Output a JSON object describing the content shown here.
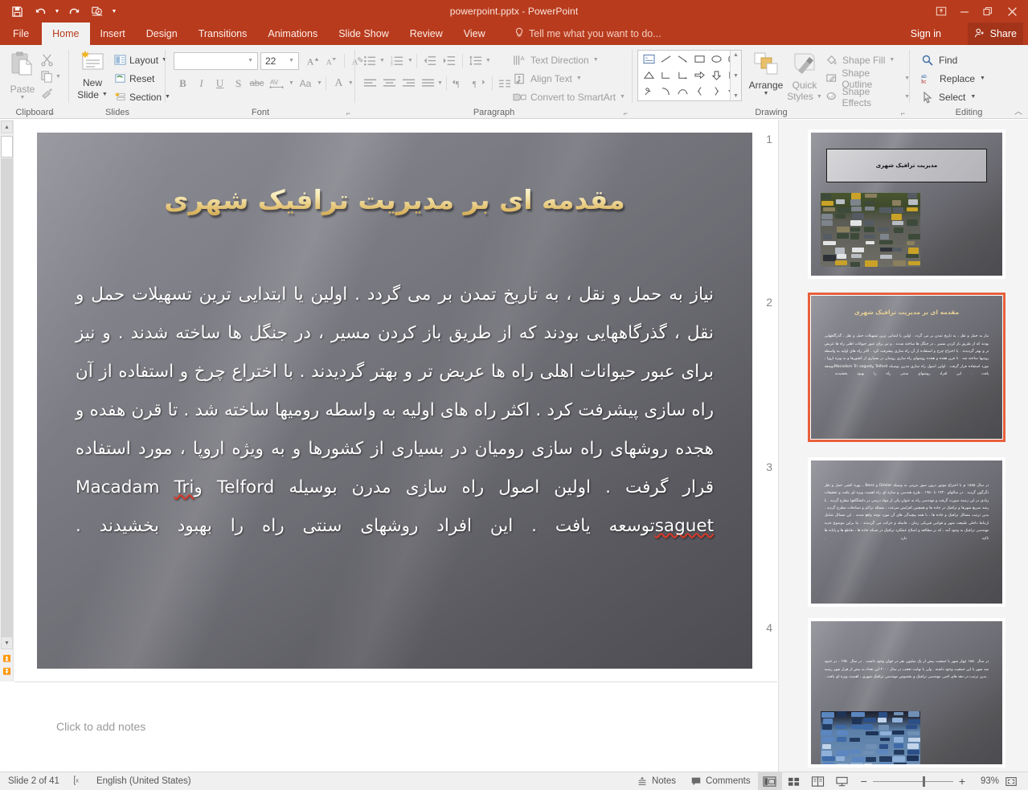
{
  "window": {
    "title": "powerpoint.pptx - PowerPoint",
    "quick_access": [
      "save-icon",
      "undo-icon",
      "redo-icon",
      "start-presentation-icon",
      "customize-qat-icon"
    ],
    "controls": [
      "ribbon-display-options-icon",
      "minimize-icon",
      "restore-icon",
      "close-icon"
    ]
  },
  "ribbon": {
    "tabs": [
      {
        "label": "File",
        "active": false
      },
      {
        "label": "Home",
        "active": true
      },
      {
        "label": "Insert",
        "active": false
      },
      {
        "label": "Design",
        "active": false
      },
      {
        "label": "Transitions",
        "active": false
      },
      {
        "label": "Animations",
        "active": false
      },
      {
        "label": "Slide Show",
        "active": false
      },
      {
        "label": "Review",
        "active": false
      },
      {
        "label": "View",
        "active": false
      }
    ],
    "tell_me": "Tell me what you want to do...",
    "sign_in": "Sign in",
    "share": "Share",
    "clipboard": {
      "group_label": "Clipboard",
      "paste_label": "Paste",
      "cut_label": "Cut",
      "copy_label": "Copy",
      "format_painter_label": "Format Painter"
    },
    "slides": {
      "group_label": "Slides",
      "new_slide_line1": "New",
      "new_slide_line2": "Slide",
      "layout_label": "Layout",
      "reset_label": "Reset",
      "section_label": "Section"
    },
    "font": {
      "group_label": "Font",
      "font_name_value": "",
      "font_name_placeholder": "",
      "font_size_value": "22",
      "buttons": [
        "B",
        "I",
        "U",
        "S",
        "abc",
        "AV",
        "Aa",
        "A"
      ]
    },
    "paragraph": {
      "group_label": "Paragraph",
      "text_direction_label": "Text Direction",
      "align_text_label": "Align Text",
      "convert_smartart_label": "Convert to SmartArt"
    },
    "drawing": {
      "group_label": "Drawing",
      "arrange_label": "Arrange",
      "quick_styles_line1": "Quick",
      "quick_styles_line2": "Styles",
      "shape_fill_label": "Shape Fill",
      "shape_outline_label": "Shape Outline",
      "shape_effects_label": "Shape Effects"
    },
    "editing": {
      "group_label": "Editing",
      "find_label": "Find",
      "replace_label": "Replace",
      "select_label": "Select"
    }
  },
  "slide": {
    "title": "مقدمه ای بر مدیریت ترافیک شهری",
    "body_html": "نیاز به حمل و نقل ، به تاریخ تمدن بر می گردد . اولین یا ابتدایی ترین تسهیلات حمل و نقل ، گذرگاههایی بودند که از طریق باز کردن مسیر ، در جنگل ها ساخته شدند . و نیز برای عبور حیوانات اهلی راه ها عریض تر و بهتر گردیدند . با اختراع چرخ و استفاده از آن راه سازی پیشرفت کرد . اکثر راه های اولیه به واسطه رومیها ساخته شد . تا قرن هفده و هجده روشهای راه سازی رومیان در بسیاری از کشورها و به ویژه اروپا ، مورد استفاده قرار گرفت . اولین اصول راه سازی مدرن بوسیله Telford  وMacadam  Tri saguetتوسعه یافت . این افراد روشهای سنتی راه را بهبود بخشیدند .",
    "misspelled_word": "Tri saguet"
  },
  "notes": {
    "placeholder": "Click to add notes"
  },
  "thumbnails": [
    {
      "number": "1",
      "selected": false,
      "title": "مدیریت ترافیک شهری",
      "has_title_box": true,
      "has_photo": true,
      "body": ""
    },
    {
      "number": "2",
      "selected": true,
      "title": "مقدمه ای بر مدیریت ترافیک شهری",
      "has_title_box": false,
      "has_photo": false,
      "body": "نیاز به حمل و نقل ، به تاریخ تمدن بر می گردد . اولین یا ابتدایی ترین تسهیلات حمل و نقل ، گذرگاههایی بودند که از طریق باز کردن مسیر ، در جنگل ها ساخته شدند . و نیز برای عبور حیوانات اهلی راه ها عریض تر و بهتر گردیدند . با اختراع چرخ و استفاده از آن راه سازی پیشرفت کرد . اکثر راه های اولیه به واسطه رومیها ساخته شد . تا قرن هفده و هجده روشهای راه سازی رومیان در بسیاری از کشورها و به ویژه اروپا ، مورد استفاده قرار گرفت . اولین اصول راه سازی مدرن بوسیله Telford وMacadam Tri saguetتوسعه یافت . این افراد روشهای سنتی راه را بهبود بخشیدند ."
    },
    {
      "number": "3",
      "selected": false,
      "title": "",
      "has_title_box": false,
      "has_photo": false,
      "body": "در سال ۱۸۸۵ م با اختراع موتور درون سوز بنزینی به وسیله Dimler و Benz ، بهره کشی حمل و نقل دگرگون گردید . در سالهای ۱۹۳۰ تا ۱۹۵۰ ، طرح هندسی و سازه ای راه اهمیت ویژه ای یافت و تحقیقات زیادی در این زمینه صورت گرفت و مهندسی راه به عنوان یکی از مواد درسی در دانشگاهها مطرح گردید . با رشد سریع شهرها و ترافیک در جاده ها و همچنین افزایش سرعت ، مسئله تراکم و تصادفات مطرح گردید . بدین ترتیب مسائل ترافیک و جاده ها ، با همه پیچیدگی های آن مورد توجه واقع شدند . این مسائل شامل ارتباط داخلی طبیعت شهر و قوانین فیزیکی زمان ، فاصله و حرکت می گردیدند . بنا براین موضوع جدید مهندسی ترافیک به وجود آمد ، که بر مطالعه و اصلاح عملکرد ترافیک در شبکه جاده ها ، تقاطع ها و پایانه ها تاکید دارد ."
    },
    {
      "number": "4",
      "selected": false,
      "title": "",
      "has_title_box": false,
      "has_photo": true,
      "body": "در سال ۱۸۵۰ چهار شهر با جمعیت بیش از یک میلیون نفر در جهان وجود داشت . در سال ۱۹۵۰ ، در حدود صد شهر با این جمعیت وجود داشته . ولی با نهایت تعجب در سال ۲۰۰۰ این تعداد به بیش از هزار شهر رسید . بدین ترتیب در دهه های اخیر، مهندسی ترافیک و بخصوص مهندسی ترافیک شهری ، اهمیت ویژه ای یافت ."
    }
  ],
  "status_bar": {
    "slide_counter": "Slide 2 of 41",
    "language": "English (United States)",
    "spell_icon": "spell-check-icon",
    "notes_label": "Notes",
    "comments_label": "Comments",
    "views": [
      "normal-view-icon",
      "slide-sorter-icon",
      "reading-view-icon",
      "slideshow-icon"
    ],
    "zoom_out": "−",
    "zoom_in": "+",
    "zoom_level": "93%",
    "fit_label": "fit-to-window-icon"
  },
  "colors": {
    "brand": "#b83b1d",
    "ribbon_bg": "#f1f1f1",
    "selected_thumb_border": "#e8603c",
    "slide_title_gold": "#f0dba8",
    "misspell_underline": "#d83a2a"
  }
}
